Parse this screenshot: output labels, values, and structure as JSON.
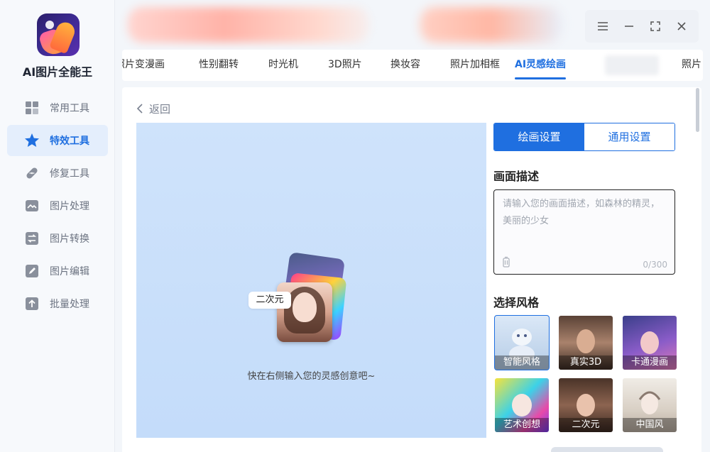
{
  "app": {
    "title": "AI图片全能王"
  },
  "sidebar": {
    "items": [
      {
        "label": "常用工具",
        "icon": "grid-icon",
        "active": false
      },
      {
        "label": "特效工具",
        "icon": "star-icon",
        "active": true
      },
      {
        "label": "修复工具",
        "icon": "bandage-icon",
        "active": false
      },
      {
        "label": "图片处理",
        "icon": "image-icon",
        "active": false
      },
      {
        "label": "图片转换",
        "icon": "convert-icon",
        "active": false
      },
      {
        "label": "图片编辑",
        "icon": "edit-icon",
        "active": false
      },
      {
        "label": "批量处理",
        "icon": "upload-icon",
        "active": false
      }
    ]
  },
  "tabs": [
    {
      "label": "照片变漫画"
    },
    {
      "label": "性别翻转"
    },
    {
      "label": "时光机"
    },
    {
      "label": "3D照片"
    },
    {
      "label": "换妆容"
    },
    {
      "label": "照片加相框"
    },
    {
      "label": "AI灵感绘画",
      "active": true
    },
    {
      "label": "照片"
    }
  ],
  "main": {
    "back_label": "返回",
    "preview": {
      "bubble": "二次元",
      "hint": "快在右侧输入您的灵感创意吧~"
    },
    "settings": {
      "tab_draw": "绘画设置",
      "tab_general": "通用设置",
      "desc_title": "画面描述",
      "desc_placeholder": "请输入您的画面描述，如森林的精灵，美丽的少女",
      "desc_count": "0/300",
      "style_title": "选择风格",
      "styles": [
        {
          "label": "智能风格"
        },
        {
          "label": "真实3D"
        },
        {
          "label": "卡通漫画"
        },
        {
          "label": "艺术创想"
        },
        {
          "label": "二次元"
        },
        {
          "label": "中国风"
        }
      ]
    }
  },
  "colors": {
    "accent": "#1f6fe0",
    "active_bg": "#e4eefc"
  }
}
